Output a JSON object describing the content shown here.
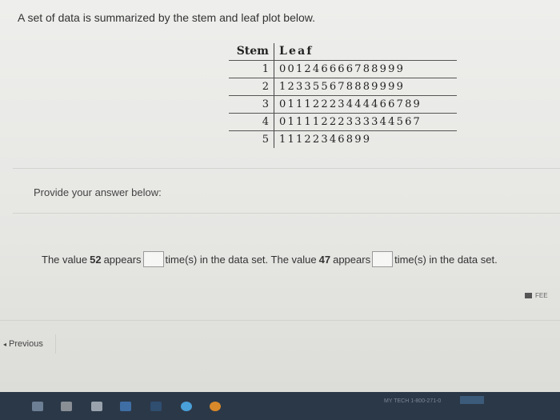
{
  "question": {
    "text": "A set of data is summarized by the stem and leaf plot below."
  },
  "stem_leaf": {
    "header_stem": "Stem",
    "header_leaf": "Leaf",
    "rows": [
      {
        "stem": "1",
        "leaf": "001246666788999"
      },
      {
        "stem": "2",
        "leaf": "123355678889999"
      },
      {
        "stem": "3",
        "leaf": "01112223444466789"
      },
      {
        "stem": "4",
        "leaf": "01111222333344567"
      },
      {
        "stem": "5",
        "leaf": "11122346899"
      }
    ]
  },
  "answer": {
    "prompt": "Provide your answer below:",
    "part1_prefix": "The value",
    "value1": "52",
    "part1_mid": "appears",
    "part1_suffix": "time(s) in the data set. The value",
    "value2": "47",
    "part2_mid": "appears",
    "part2_suffix": "time(s) in the data set.",
    "input1_value": "",
    "input2_value": ""
  },
  "feedback": {
    "label": "FEE"
  },
  "nav": {
    "previous_label": "Previous"
  },
  "taskbar": {
    "tray_text": "MY TECH 1-800-271-0"
  },
  "colors": {
    "page_bg": "#eeeeec",
    "taskbar_bg": "#2b3848",
    "text": "#333333"
  }
}
